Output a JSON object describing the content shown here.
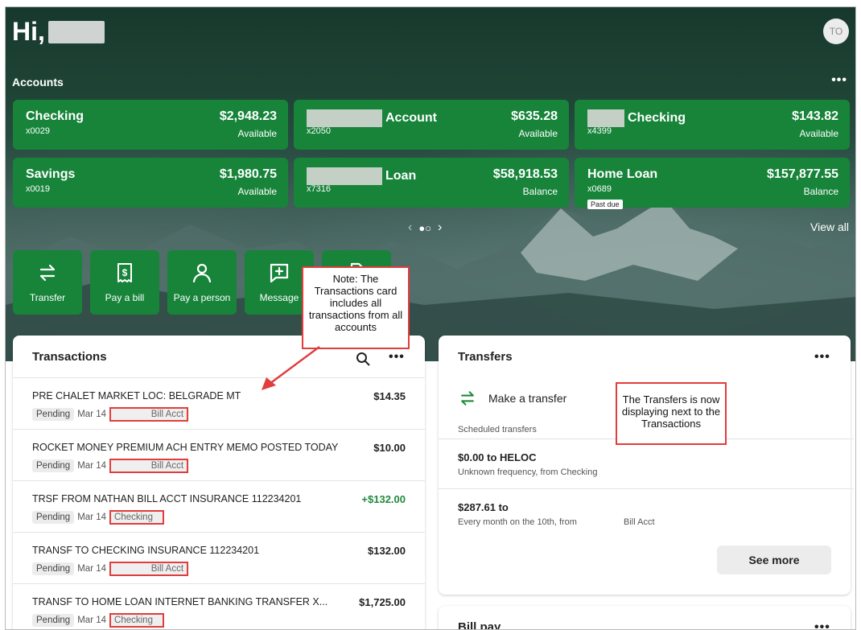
{
  "greeting": "Hi,",
  "avatar_initials": "TO",
  "accounts": {
    "label": "Accounts",
    "more": "•••",
    "items": [
      {
        "name": "Checking",
        "number": "x0029",
        "amount": "$2,948.23",
        "sub": "Available"
      },
      {
        "name": "Account",
        "number": "x2050",
        "amount": "$635.28",
        "sub": "Available"
      },
      {
        "name": "Checking",
        "number": "x4399",
        "amount": "$143.82",
        "sub": "Available"
      },
      {
        "name": "Savings",
        "number": "x0019",
        "amount": "$1,980.75",
        "sub": "Available"
      },
      {
        "name": "Loan",
        "number": "x7316",
        "amount": "$58,918.53",
        "sub": "Balance"
      },
      {
        "name": "Home Loan",
        "number": "x0689",
        "amount": "$157,877.55",
        "sub": "Balance",
        "badge": "Past due"
      }
    ],
    "view_all": "View all",
    "pager": {
      "prev": "‹",
      "dots": "●○",
      "next": "›"
    }
  },
  "quick_actions": [
    {
      "label": "Transfer",
      "icon": "transfer-icon"
    },
    {
      "label": "Pay a bill",
      "icon": "bill-icon"
    },
    {
      "label": "Pay a person",
      "icon": "person-icon"
    },
    {
      "label": "Message",
      "icon": "message-icon"
    }
  ],
  "transactions": {
    "title": "Transactions",
    "more": "•••",
    "rows": [
      {
        "desc": "PRE CHALET MARKET LOC: BELGRADE MT",
        "amount": "$14.35",
        "status": "Pending",
        "date": "Mar 14",
        "account": "Bill Acct"
      },
      {
        "desc": "ROCKET MONEY PREMIUM ACH ENTRY MEMO POSTED TODAY",
        "amount": "$10.00",
        "status": "Pending",
        "date": "Mar 14",
        "account": "Bill Acct"
      },
      {
        "desc": "TRSF FROM NATHAN BILL ACCT INSURANCE 112234201",
        "amount": "+$132.00",
        "status": "Pending",
        "date": "Mar 14",
        "account": "Checking"
      },
      {
        "desc": "TRANSF TO CHECKING INSURANCE 112234201",
        "amount": "$132.00",
        "status": "Pending",
        "date": "Mar 14",
        "account": "Bill Acct"
      },
      {
        "desc": "TRANSF TO HOME LOAN INTERNET BANKING TRANSFER X...",
        "amount": "$1,725.00",
        "status": "Pending",
        "date": "Mar 14",
        "account": "Checking"
      }
    ]
  },
  "transfers": {
    "title": "Transfers",
    "more": "•••",
    "make_transfer": "Make a transfer",
    "scheduled_label": "Scheduled transfers",
    "scheduled": [
      {
        "title": "$0.00 to HELOC",
        "detail": "Unknown frequency, from Checking"
      },
      {
        "title": "$287.61 to",
        "detail": "Every month on the 10th, from",
        "detail_account": "Bill Acct"
      }
    ],
    "see_more": "See more"
  },
  "bill_pay": {
    "title": "Bill pay",
    "more": "•••"
  },
  "annotations": {
    "transactions_note": "Note: The Transactions card includes all transactions from all accounts",
    "transfers_note": "The Transfers is now displaying next to the Transactions"
  },
  "colors": {
    "brand_green": "#17843a",
    "positive": "#1f8a3b",
    "callout_red": "#e23c3c"
  }
}
